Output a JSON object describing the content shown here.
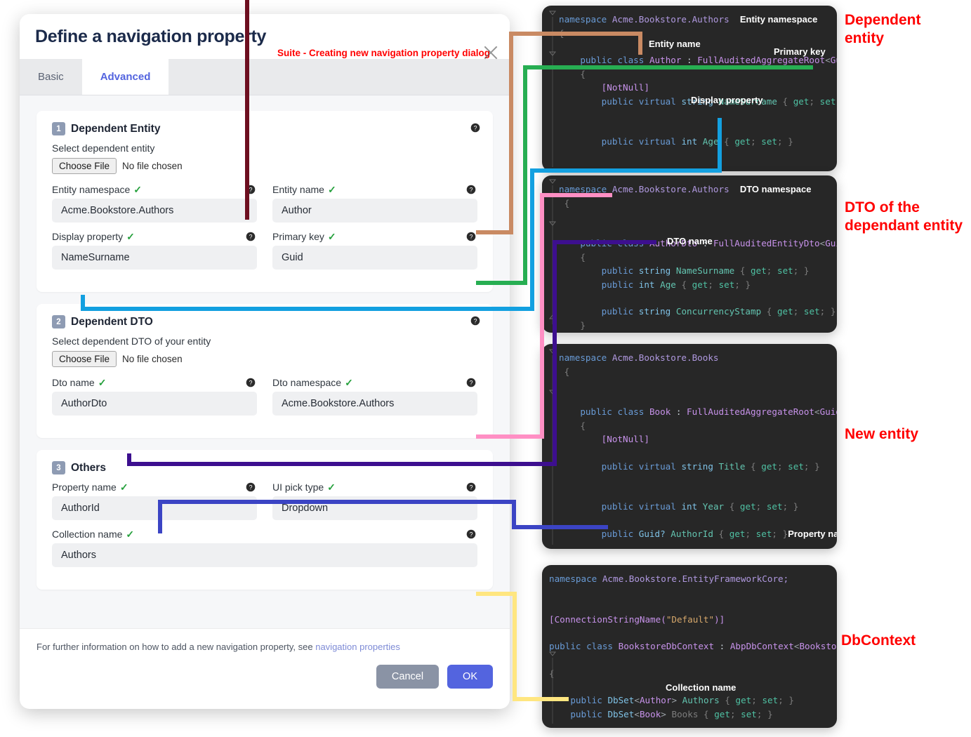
{
  "dialog": {
    "title": "Define a navigation property",
    "annotation": "Suite - Creating new navigation property dialog",
    "close_icon": "close-icon",
    "tabs": [
      {
        "label": "Basic",
        "active": false
      },
      {
        "label": "Advanced",
        "active": true
      }
    ],
    "sections": [
      {
        "number": "1",
        "title": "Dependent Entity",
        "sub_label": "Select dependent entity",
        "file_button": "Choose File",
        "file_status": "No file chosen",
        "fields": [
          {
            "label": "Entity namespace",
            "value": "Acme.Bookstore.Authors",
            "valid": true
          },
          {
            "label": "Entity name",
            "value": "Author",
            "valid": true
          },
          {
            "label": "Display property",
            "value": "NameSurname",
            "valid": true
          },
          {
            "label": "Primary key",
            "value": "Guid",
            "valid": true
          }
        ]
      },
      {
        "number": "2",
        "title": "Dependent DTO",
        "sub_label": "Select dependent DTO of your entity",
        "file_button": "Choose File",
        "file_status": "No file chosen",
        "fields": [
          {
            "label": "Dto name",
            "value": "AuthorDto",
            "valid": true
          },
          {
            "label": "Dto namespace",
            "value": "Acme.Bookstore.Authors",
            "valid": true
          }
        ]
      },
      {
        "number": "3",
        "title": "Others",
        "sub_label": "",
        "fields": [
          {
            "label": "Property name",
            "value": "AuthorId",
            "valid": true
          },
          {
            "label": "UI pick type",
            "value": "Dropdown",
            "valid": true
          },
          {
            "label": "Collection name",
            "value": "Authors",
            "valid": true
          }
        ]
      }
    ],
    "footer": {
      "note_text": "For further information on how to add a new navigation property, see ",
      "note_link": "navigation properties",
      "cancel_label": "Cancel",
      "ok_label": "OK"
    }
  },
  "code_panels": [
    {
      "id": "entity",
      "red_label": "Dependent entity",
      "annotations": [
        "Entity namespace",
        "Entity name",
        "Primary key",
        "Display property"
      ],
      "lines": [
        "namespace Acme.Bookstore.Authors",
        "{",
        "    public class Author : FullAuditedAggregateRoot<Guid>",
        "    {",
        "        [NotNull]",
        "        public virtual string NameSurname { get; set; }",
        "        public virtual int Age { get; set; }"
      ]
    },
    {
      "id": "dto",
      "red_label": "DTO of the dependant entity",
      "annotations": [
        "DTO namespace",
        "DTO name"
      ],
      "lines": [
        "namespace Acme.Bookstore.Authors",
        "{",
        "    public class AuthorDto : FullAuditedEntityDto<Guid>",
        "    {",
        "        public string NameSurname { get; set; }",
        "        public int Age { get; set; }",
        "        public string ConcurrencyStamp { get; set; }",
        "}"
      ]
    },
    {
      "id": "book",
      "red_label": "New entity",
      "annotations": [
        "Property name"
      ],
      "lines": [
        "namespace Acme.Bookstore.Books",
        "{",
        "    public class Book : FullAuditedAggregateRoot<Guid>",
        "    {",
        "        [NotNull]",
        "        public virtual string Title { get; set; }",
        "        public virtual int Year { get; set; }",
        "        public Guid? AuthorId { get; set; }"
      ]
    },
    {
      "id": "dbcontext",
      "red_label": "DbContext",
      "annotations": [
        "Collection name"
      ],
      "lines": [
        "namespace Acme.Bookstore.EntityFrameworkCore;",
        "[ConnectionStringName(\"Default\")]",
        "public class BookstoreDbContext : AbpDbContext<BookstoreDbC",
        "{",
        "    public DbSet<Author> Authors { get; set; }",
        "    public DbSet<Book> Books { get; set; }"
      ]
    }
  ],
  "connector_colors": {
    "entity_namespace": "#6d0f20",
    "entity_name": "#c98a63",
    "primary_key": "#27ae52",
    "display_property": "#13a0e0",
    "dto_namespace": "#ff8fc4",
    "dto_name": "#3d0f8f",
    "property_name": "#3b44c4",
    "collection_name": "#ffe680"
  }
}
